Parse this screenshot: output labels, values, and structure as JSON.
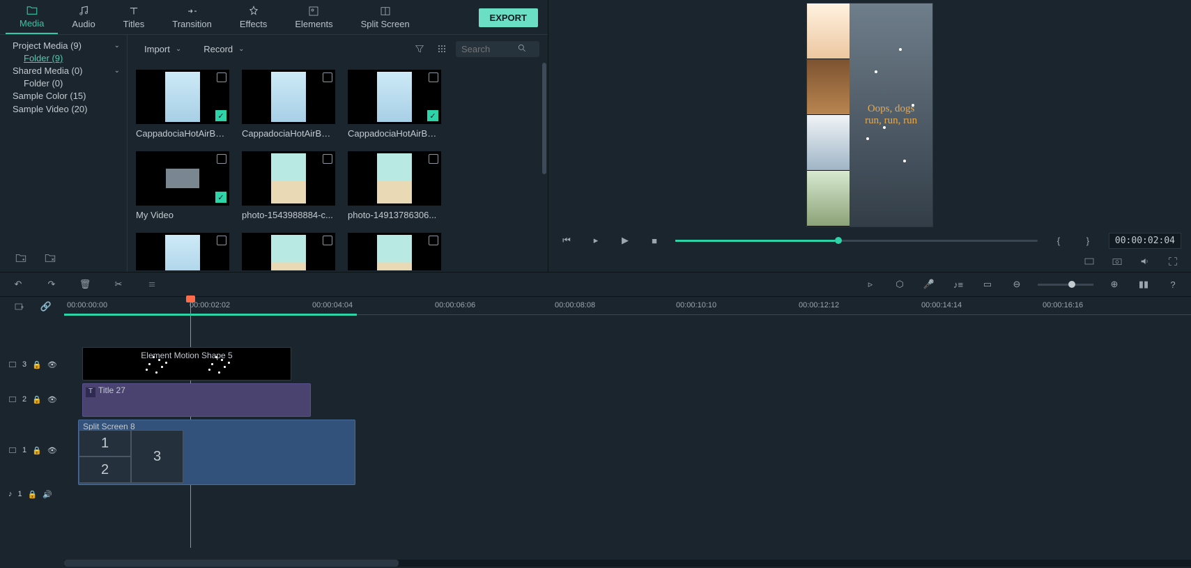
{
  "tabs": {
    "media": "Media",
    "audio": "Audio",
    "titles": "Titles",
    "transition": "Transition",
    "effects": "Effects",
    "elements": "Elements",
    "splitscreen": "Split Screen"
  },
  "export_label": "EXPORT",
  "sidebar": {
    "project_media": "Project Media (9)",
    "folder9": "Folder (9)",
    "shared_media": "Shared Media (0)",
    "folder0": "Folder (0)",
    "sample_color": "Sample Color (15)",
    "sample_video": "Sample Video (20)"
  },
  "toolbar": {
    "import": "Import",
    "record": "Record",
    "search_placeholder": "Search"
  },
  "media_items": [
    {
      "name": "CappadociaHotAirBall...",
      "checked": true
    },
    {
      "name": "CappadociaHotAirBall...",
      "checked": false
    },
    {
      "name": "CappadociaHotAirBall...",
      "checked": true
    },
    {
      "name": "My Video",
      "checked": true
    },
    {
      "name": "photo-1543988884-c...",
      "checked": false
    },
    {
      "name": "photo-14913786306...",
      "checked": false
    },
    {
      "name": "",
      "checked": false
    },
    {
      "name": "",
      "checked": false
    },
    {
      "name": "",
      "checked": false
    }
  ],
  "preview": {
    "overlay_text": "Oops, dogs\nrun, run, run",
    "timecode": "00:00:02:04"
  },
  "ruler": [
    "00:00:00:00",
    "00:00:02:02",
    "00:00:04:04",
    "00:00:06:06",
    "00:00:08:08",
    "00:00:10:10",
    "00:00:12:12",
    "00:00:14:14",
    "00:00:16:16"
  ],
  "tracks": {
    "t3": "3",
    "t2": "2",
    "t1v": "1",
    "t1a": "1",
    "clip_elem": "Element Motion Shape 5",
    "clip_title": "Title 27",
    "clip_split": "Split Screen 8",
    "split_cells": [
      "1",
      "2",
      "3"
    ]
  }
}
